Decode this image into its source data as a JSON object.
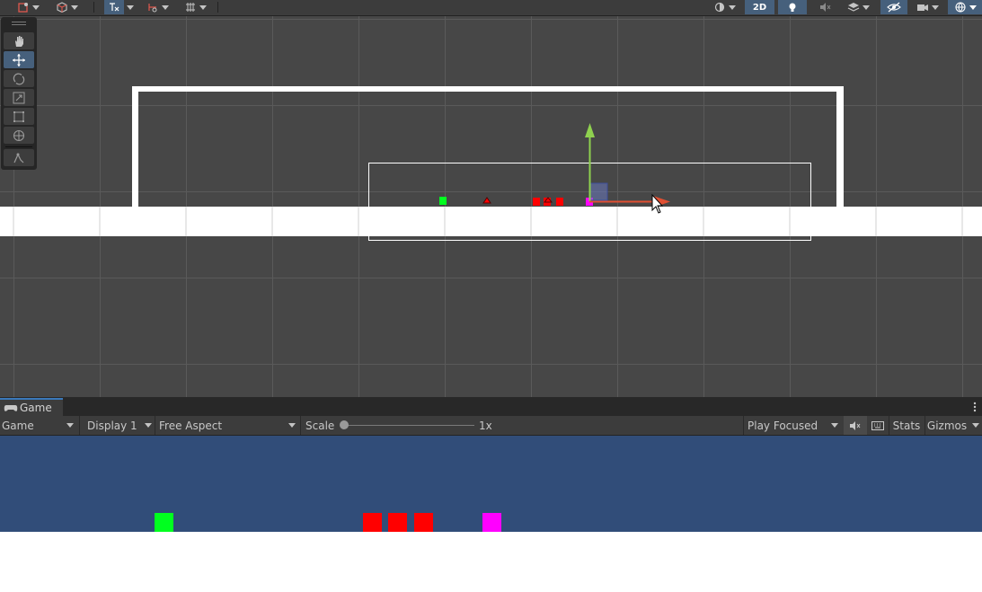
{
  "scene_toolbar": {
    "btn_2d_label": "2D",
    "mode_2d_active": true
  },
  "tools": [
    "hand-tool",
    "move-tool",
    "rotate-tool",
    "scale-tool",
    "rect-tool",
    "transform-tool",
    "custom-tool"
  ],
  "selected_tool": "move-tool",
  "game_panel": {
    "tab_label": "Game",
    "view_dropdown": "Game",
    "display_dropdown": "Display 1",
    "aspect_dropdown": "Free Aspect",
    "scale_label": "Scale",
    "scale_value": "1x",
    "scale_slider_fraction": 0.0,
    "play_mode_dropdown": "Play Focused",
    "stats_label": "Stats",
    "gizmos_label": "Gizmos"
  },
  "colors": {
    "player": "#00ff1f",
    "enemy": "#ff0000",
    "pickup": "#ff00ff",
    "game_background": "#314d79",
    "scene_background": "#474747",
    "accent": "#46607c"
  }
}
